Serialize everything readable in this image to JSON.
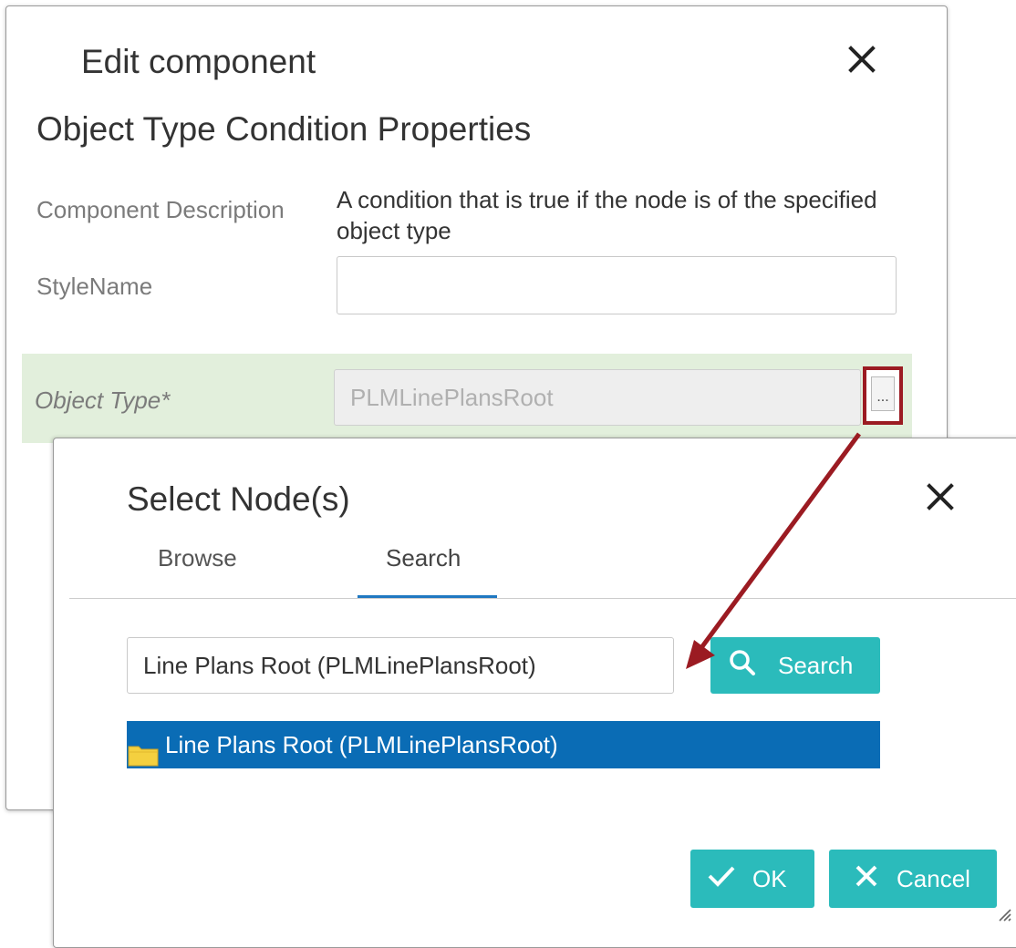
{
  "edit_dialog": {
    "title": "Edit component",
    "close_icon": "close-icon",
    "section_title": "Object Type Condition Properties",
    "component_description_label": "Component Description",
    "component_description_value": "A condition that is true if the node is of the specified object type",
    "stylename_label": "StyleName",
    "stylename_value": "",
    "object_type_label": "Object Type*",
    "object_type_value": "PLMLinePlansRoot",
    "browse_button_label": "..."
  },
  "select_dialog": {
    "title": "Select Node(s)",
    "close_icon": "close-icon",
    "tabs": [
      {
        "label": "Browse",
        "active": false
      },
      {
        "label": "Search",
        "active": true
      }
    ],
    "search_value": "Line Plans Root (PLMLinePlansRoot)",
    "search_button_label": "Search",
    "results": [
      {
        "label": "Line Plans Root (PLMLinePlansRoot)",
        "icon": "folder-icon",
        "selected": true
      }
    ],
    "ok_label": "OK",
    "cancel_label": "Cancel"
  },
  "colors": {
    "accent_teal": "#2bbbbb",
    "selection_blue": "#0a6cb5",
    "highlight_green": "#e2efdc",
    "annotation_red": "#9b1b22",
    "tab_underline": "#1f78c1"
  }
}
